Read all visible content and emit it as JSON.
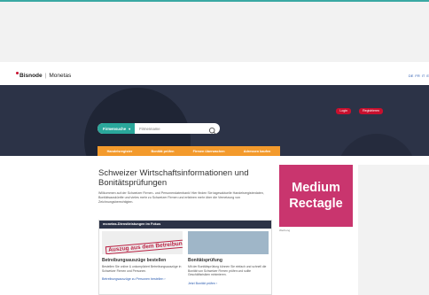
{
  "brand": {
    "name_bold": "Bisnode",
    "name_rest": "Monetas"
  },
  "langs": [
    "DE",
    "FR",
    "IT",
    "E"
  ],
  "auth": {
    "login": "Login",
    "register": "Registrieren"
  },
  "search": {
    "type_label": "Firmensuche",
    "placeholder": "Firmenname"
  },
  "nav": [
    "Handelsregister",
    "Bonität prüfen",
    "Firmen überwachen",
    "Adressen kaufen"
  ],
  "main": {
    "title": "Schweizer Wirtschaftsinformationen und Bonitätsprüfungen",
    "intro_text": "Willkommen auf der Schweizer Firmen- und Personendatenbank! Hier finden Sie tagesaktuelle Handelsregisterdaten, Bonitätsauskünfte und vieles mehr zu Schweizer Firmen und erfahren mehr über die Vernetzung von Zeichnungsberechtigten."
  },
  "ad": {
    "line1": "Medium",
    "line2": "Rectagle",
    "label": "Werbung"
  },
  "services": {
    "heading": "monetas-Dienstleistungen im Fokus",
    "cards": [
      {
        "stamp": "Auszug aus dem Betreibungsregister",
        "title": "Betreibungsauszüge bestellen",
        "text": "Bestellen Sie online & unkompliziert Betreibungsauszüge in Schweizer Firmen und Personen.",
        "link": "Betreibungsauszüge zu Personen bestellen"
      },
      {
        "title": "Bonitätsprüfung",
        "text": "Mit der Bonitätsprüfung können Sie einfach und schnell die Bonität von Schweizer Firmen prüfen und sollte Geschäftsrisiken minimieren.",
        "link": "Jetzt Bonität prüfen"
      }
    ]
  }
}
